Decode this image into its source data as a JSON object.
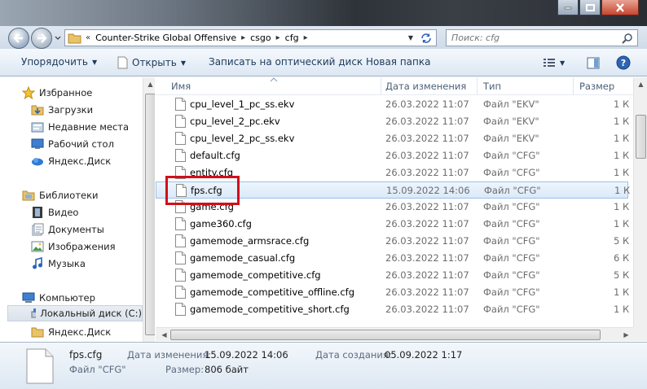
{
  "addressbar": {
    "crumbs": [
      "Counter-Strike Global Offensive",
      "csgo",
      "cfg"
    ]
  },
  "search": {
    "placeholder": "Поиск: cfg"
  },
  "toolbar": {
    "organize": "Упорядочить",
    "open": "Открыть",
    "burn": "Записать на оптический диск",
    "new_folder": "Новая папка"
  },
  "sidebar": {
    "favorites": "Избранное",
    "downloads": "Загрузки",
    "recent": "Недавние места",
    "desktop": "Рабочий стол",
    "yadisk": "Яндекс.Диск",
    "libraries": "Библиотеки",
    "video": "Видео",
    "documents": "Документы",
    "images": "Изображения",
    "music": "Музыка",
    "computer": "Компьютер",
    "local_disk": "Локальный диск (C:)",
    "yadisk2": "Яндекс.Диск"
  },
  "columns": {
    "name": "Имя",
    "date": "Дата изменения",
    "type": "Тип",
    "size": "Размер"
  },
  "files": [
    {
      "name": "cpu_level_1_pc_ss.ekv",
      "date": "26.03.2022 11:07",
      "type": "Файл \"EKV\"",
      "size": "1 К"
    },
    {
      "name": "cpu_level_2_pc.ekv",
      "date": "26.03.2022 11:07",
      "type": "Файл \"EKV\"",
      "size": "1 К"
    },
    {
      "name": "cpu_level_2_pc_ss.ekv",
      "date": "26.03.2022 11:07",
      "type": "Файл \"EKV\"",
      "size": "1 К"
    },
    {
      "name": "default.cfg",
      "date": "26.03.2022 11:07",
      "type": "Файл \"CFG\"",
      "size": "1 К"
    },
    {
      "name": "entity.cfg",
      "date": "26.03.2022 11:07",
      "type": "Файл \"CFG\"",
      "size": "1 К"
    },
    {
      "name": "fps.cfg",
      "date": "15.09.2022 14:06",
      "type": "Файл \"CFG\"",
      "size": "1 К"
    },
    {
      "name": "game.cfg",
      "date": "26.03.2022 11:07",
      "type": "Файл \"CFG\"",
      "size": "1 К"
    },
    {
      "name": "game360.cfg",
      "date": "26.03.2022 11:07",
      "type": "Файл \"CFG\"",
      "size": "1 К"
    },
    {
      "name": "gamemode_armsrace.cfg",
      "date": "26.03.2022 11:07",
      "type": "Файл \"CFG\"",
      "size": "5 К"
    },
    {
      "name": "gamemode_casual.cfg",
      "date": "26.03.2022 11:07",
      "type": "Файл \"CFG\"",
      "size": "6 К"
    },
    {
      "name": "gamemode_competitive.cfg",
      "date": "26.03.2022 11:07",
      "type": "Файл \"CFG\"",
      "size": "5 К"
    },
    {
      "name": "gamemode_competitive_offline.cfg",
      "date": "26.03.2022 11:07",
      "type": "Файл \"CFG\"",
      "size": "1 К"
    },
    {
      "name": "gamemode_competitive_short.cfg",
      "date": "26.03.2022 11:07",
      "type": "Файл \"CFG\"",
      "size": "1 К"
    }
  ],
  "details": {
    "filename": "fps.cfg",
    "filetype": "Файл \"CFG\"",
    "modified_label": "Дата изменения:",
    "modified_value": "15.09.2022 14:06",
    "created_label": "Дата создания:",
    "created_value": "05.09.2022 1:17",
    "size_label": "Размер:",
    "size_value": "806 байт"
  },
  "colors": {
    "highlight_box": "#d10f1a",
    "selection": "#dbe9f9"
  }
}
